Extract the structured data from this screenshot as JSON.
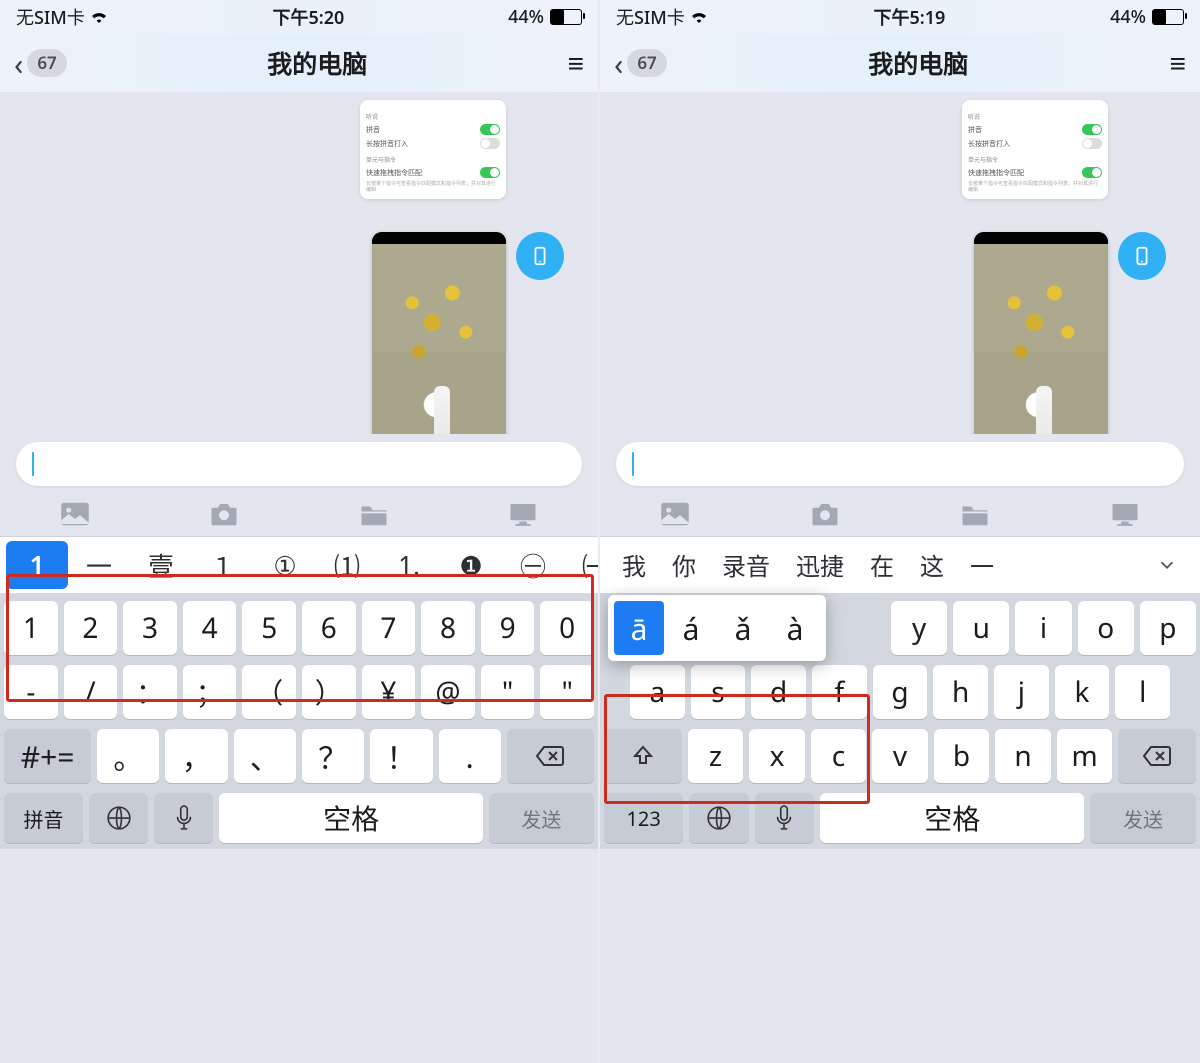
{
  "left": {
    "status": {
      "carrier": "无SIM卡",
      "time": "下午5:20",
      "battery_pct": "44%",
      "battery_level": 0.44
    },
    "nav": {
      "back_badge": "67",
      "title": "我的电脑"
    },
    "settings_card": {
      "section1": "听说",
      "row1_label": "拼音",
      "row2_label": "长按拼音打入",
      "section2": "单元与指令",
      "row3_label": "快速拖拽指令匹配",
      "sub": "长按某个指令可查看指令匹配模式和指令列表，并对其进行编辑"
    },
    "candidates": {
      "items": [
        "1",
        "一",
        "壹",
        "１",
        "①",
        "⑴",
        "1.",
        "❶",
        "㊀",
        "㈠"
      ],
      "selected_index": 0
    },
    "kb": {
      "row1": [
        "1",
        "2",
        "3",
        "4",
        "5",
        "6",
        "7",
        "8",
        "9",
        "0"
      ],
      "row2": [
        "-",
        "/",
        "：",
        "；",
        "（",
        "）",
        "¥",
        "@",
        "\"",
        "\""
      ],
      "row3_prefix": "#+=",
      "row3": [
        "。",
        "，",
        "、",
        "？",
        "！",
        "."
      ],
      "bottom": {
        "left": "拼音",
        "space": "空格",
        "send": "发送"
      }
    }
  },
  "right": {
    "status": {
      "carrier": "无SIM卡",
      "time": "下午5:19",
      "battery_pct": "44%",
      "battery_level": 0.44
    },
    "nav": {
      "back_badge": "67",
      "title": "我的电脑"
    },
    "settings_card": {
      "section1": "听说",
      "row1_label": "拼音",
      "row2_label": "长按拼音打入",
      "section2": "单元与指令",
      "row3_label": "快速拖拽指令匹配",
      "sub": "长按某个指令可查看指令匹配模式和指令列表，并对其进行编辑"
    },
    "candidates": {
      "items": [
        "我",
        "你",
        "录音",
        "迅捷",
        "在",
        "这",
        "一"
      ],
      "has_more": true
    },
    "accent_popup": {
      "items": [
        "ā",
        "á",
        "ǎ",
        "à"
      ],
      "selected_index": 0
    },
    "kb": {
      "row1_visible": [
        "y",
        "u",
        "i",
        "o",
        "p"
      ],
      "row2": [
        "a",
        "s",
        "d",
        "f",
        "g",
        "h",
        "j",
        "k",
        "l"
      ],
      "row3": [
        "z",
        "x",
        "c",
        "v",
        "b",
        "n",
        "m"
      ],
      "bottom": {
        "left": "123",
        "space": "空格",
        "send": "发送"
      }
    }
  }
}
